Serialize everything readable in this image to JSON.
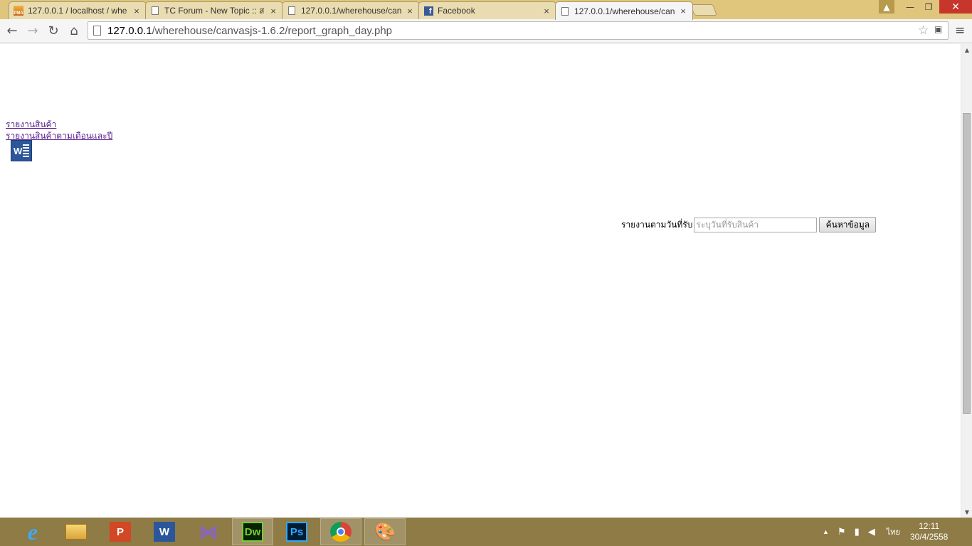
{
  "tabs": [
    {
      "title": "127.0.0.1 / localhost / whe",
      "favicon": "phpmyadmin-icon",
      "active": false
    },
    {
      "title": "TC Forum - New Topic :: ส",
      "favicon": "page-icon",
      "active": false
    },
    {
      "title": "127.0.0.1/wherehouse/can",
      "favicon": "page-icon",
      "active": false
    },
    {
      "title": "Facebook",
      "favicon": "facebook-icon",
      "active": false
    },
    {
      "title": "127.0.0.1/wherehouse/can",
      "favicon": "page-icon",
      "active": true
    }
  ],
  "tab_close_glyph": "×",
  "window": {
    "user": "▲",
    "minimize": "—",
    "maximize": "❐",
    "close": "✕"
  },
  "toolbar": {
    "back": "←",
    "forward": "→",
    "reload": "↻",
    "home": "⌂",
    "url_host": "127.0.0.1",
    "url_path": "/wherehouse/canvasjs-1.6.2/report_graph_day.php",
    "star": "☆",
    "menu": "≡"
  },
  "page": {
    "links": [
      "รายงานสินค้า",
      "รายงานสินค้าตามเดือนและปี"
    ],
    "word_icon_letter": "W",
    "search": {
      "label": "รายงานตามวันที่รับ",
      "placeholder": "ระบุวันที่รับสินค้า",
      "button": "ค้นหาข้อมูล"
    }
  },
  "scrollbar": {
    "up": "▲",
    "down": "▼"
  },
  "taskbar": {
    "apps": [
      {
        "name": "internet-explorer",
        "glyph": "e",
        "open": false
      },
      {
        "name": "file-explorer",
        "glyph": "",
        "open": false
      },
      {
        "name": "powerpoint",
        "glyph": "P",
        "open": false
      },
      {
        "name": "word",
        "glyph": "W",
        "open": false
      },
      {
        "name": "visual-studio",
        "glyph": "⋈",
        "open": false
      },
      {
        "name": "dreamweaver",
        "glyph": "Dw",
        "open": true
      },
      {
        "name": "photoshop",
        "glyph": "Ps",
        "open": false
      },
      {
        "name": "chrome",
        "glyph": "",
        "open": true
      },
      {
        "name": "paint",
        "glyph": "🎨",
        "open": true
      }
    ],
    "tray": {
      "chevron": "▲",
      "language": "ไทย",
      "time": "12:11",
      "date": "30/4/2558"
    }
  }
}
